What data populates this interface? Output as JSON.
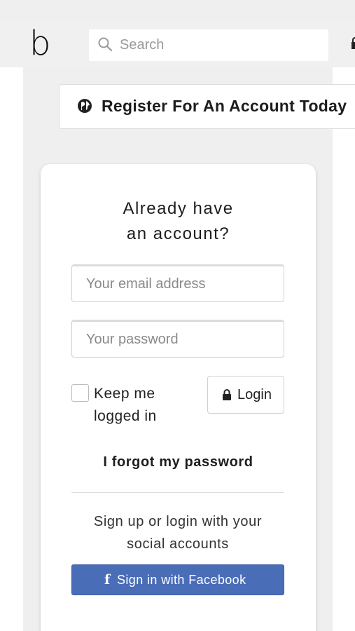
{
  "header": {
    "logo": "b",
    "search_placeholder": "Search"
  },
  "banner": {
    "text": "Register For An Account Today"
  },
  "login_card": {
    "title": "Already have an account?",
    "email_placeholder": "Your email address",
    "password_placeholder": "Your password",
    "keep_logged_in": "Keep me logged in",
    "login_button": "Login",
    "forgot_link": "I forgot my password",
    "social_text": "Sign up or login with your social accounts",
    "facebook_button": "Sign in with Facebook"
  },
  "colors": {
    "facebook": "#4a6db8",
    "page_bg": "#efefef"
  },
  "icons": {
    "search": "search-icon",
    "globe": "globe-icon",
    "lock": "lock-icon",
    "facebook": "facebook-icon"
  }
}
